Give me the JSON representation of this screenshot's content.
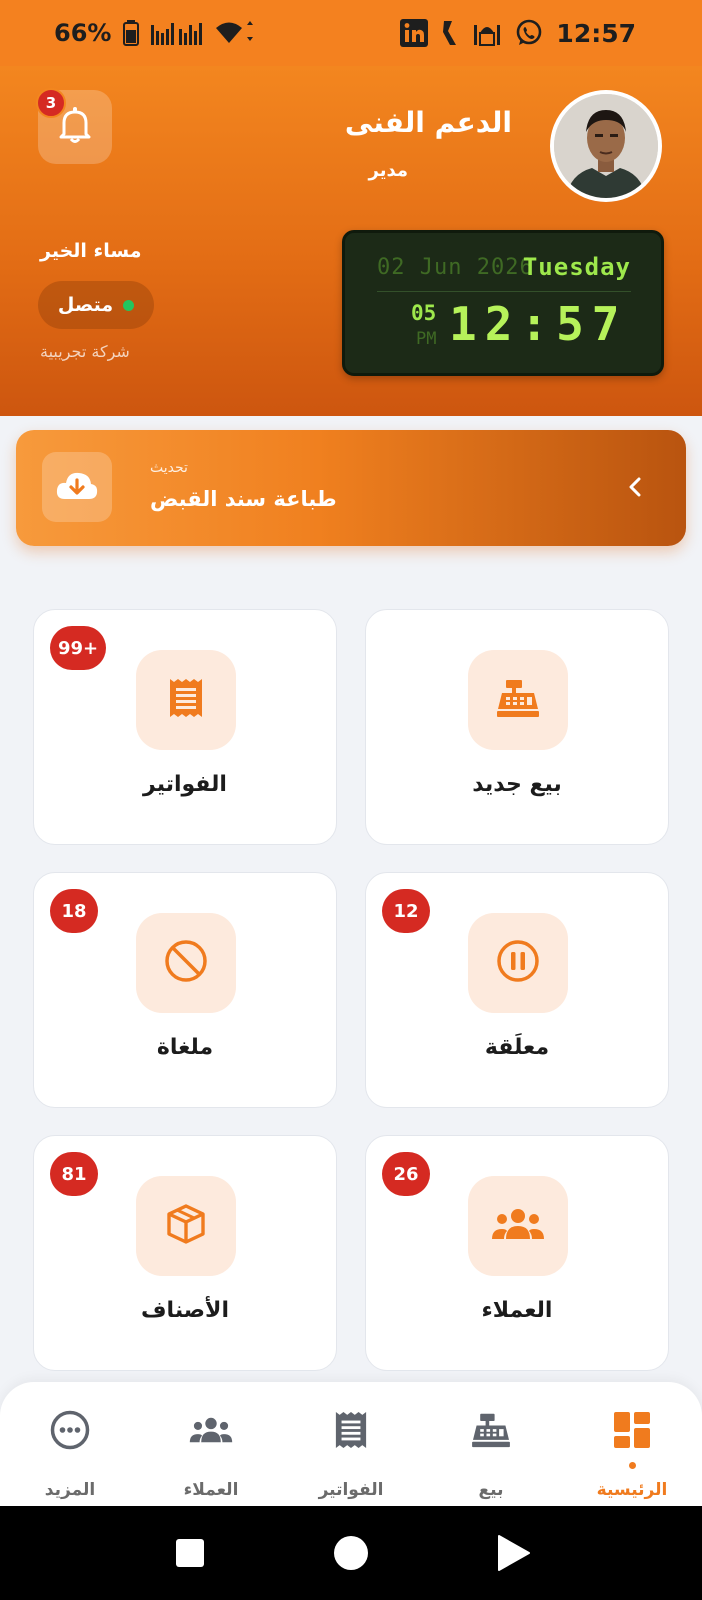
{
  "status_bar": {
    "battery": "66%",
    "time": "12:57"
  },
  "profile": {
    "name": "الدعم الفنى",
    "role": "مدير",
    "notifications_count": "3",
    "greeting": "مساء الخير",
    "status": "متصل",
    "company": "شركة تجريبية"
  },
  "clock": {
    "date": "02 Jun 2026",
    "day": "Tuesday",
    "seconds": "05",
    "ampm": "PM",
    "time": "12:57"
  },
  "banner": {
    "subtitle": "تحديث",
    "title": "طباعة سند القبض"
  },
  "cards": {
    "new_sale": {
      "label": "بيع جديد"
    },
    "invoices": {
      "label": "الفواتير",
      "badge": "99+"
    },
    "suspended": {
      "label": "معلَقة",
      "badge": "12"
    },
    "cancelled": {
      "label": "ملغاة",
      "badge": "18"
    },
    "customers": {
      "label": "العملاء",
      "badge": "26"
    },
    "items": {
      "label": "الأصناف",
      "badge": "81"
    }
  },
  "bottom_nav": {
    "home": "الرئيسية",
    "sale": "بيع",
    "invoices": "الفواتير",
    "customers": "العملاء",
    "more": "المزيد"
  },
  "colors": {
    "accent": "#f07b1e",
    "badge": "#d52a22",
    "online": "#23c55e"
  }
}
